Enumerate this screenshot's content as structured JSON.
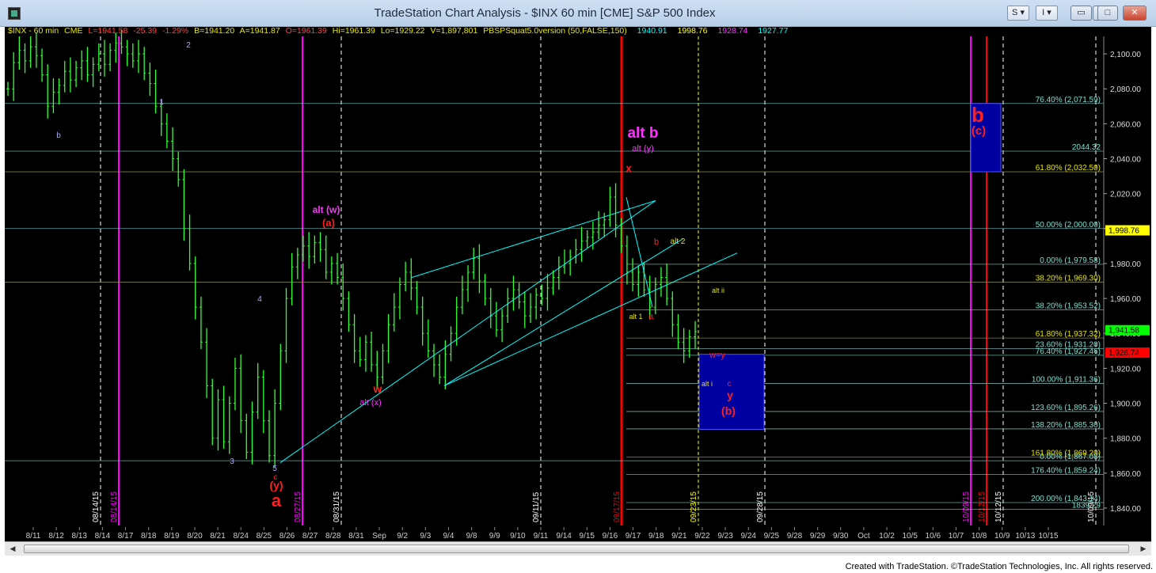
{
  "window": {
    "title": "TradeStation Chart Analysis - $INX 60 min [CME] S&P 500 Index",
    "symbol_button": "S",
    "chart_button": "I"
  },
  "header": {
    "symbol": "$INX - 60 min",
    "exchange": "CME",
    "last": "L=1941.58",
    "change": "-25.39",
    "change_pct": "-1.29%",
    "bid": "B=1941.20",
    "ask": "A=1941.87",
    "open": "O=1961.39",
    "high": "Hi=1961.39",
    "low": "Lo=1929.22",
    "volume": "V=1,897,801",
    "study": "PBSPSquat5.0version (50,FALSE,150)",
    "v1": "1940.91",
    "v2": "1998.76",
    "v3": "1928.74",
    "v4": "1927.77"
  },
  "colors": {
    "background": "#000000",
    "bars": "#33ff33",
    "price_label_up": "#ffff00",
    "price_label_down": "#ff0000",
    "trend_line": "#00ffff",
    "time_marker_magenta": "#ff00ff",
    "time_marker_red": "#ff0000",
    "box": "#0000a0",
    "wave_red": "#ff2020",
    "wave_magenta": "#ff33ff",
    "fib_text": "#7fdfd0",
    "fib_yellow": "#e6e600"
  },
  "chart_data": {
    "type": "bar",
    "instrument": "$INX",
    "interval": "60 min",
    "ylim": [
      1830,
      2110
    ],
    "y_ticks": [
      "2,100.00",
      "2,080.00",
      "2,060.00",
      "2,040.00",
      "2,020.00",
      "2,000.00",
      "1,980.00",
      "1,960.00",
      "1,940.00",
      "1,920.00",
      "1,900.00",
      "1,880.00",
      "1,860.00",
      "1,840.00"
    ],
    "y_tick_values": [
      2100,
      2080,
      2060,
      2040,
      2020,
      2000,
      1980,
      1960,
      1940,
      1920,
      1900,
      1880,
      1860,
      1840
    ],
    "x_labels": [
      "8/11",
      "8/12",
      "8/13",
      "8/14",
      "8/17",
      "8/18",
      "8/19",
      "8/20",
      "8/21",
      "8/24",
      "8/25",
      "8/26",
      "8/27",
      "8/28",
      "8/31",
      "Sep",
      "9/2",
      "9/3",
      "9/4",
      "9/8",
      "9/9",
      "9/10",
      "9/11",
      "9/14",
      "9/15",
      "9/16",
      "9/17",
      "9/18",
      "9/21",
      "9/22",
      "9/23",
      "9/24",
      "9/25",
      "9/28",
      "9/29",
      "9/30",
      "Oct",
      "10/2",
      "10/5",
      "10/6",
      "10/7",
      "10/8",
      "10/9",
      "10/13",
      "10/15"
    ],
    "price_markers": [
      {
        "label": "1,998.76",
        "value": 1998.76,
        "color": "#ffff00"
      },
      {
        "label": "1,941.58",
        "value": 1941.58,
        "color": "#00ff00"
      },
      {
        "label": "1,928.74",
        "value": 1928.74,
        "color": "#ff0000"
      }
    ],
    "fib_levels": [
      {
        "label": "76.40% (2,071.59)",
        "value": 2071.59
      },
      {
        "label": "2044.32",
        "value": 2044.32
      },
      {
        "label": "61.80% (2,032.50)",
        "value": 2032.5
      },
      {
        "label": "50.00% (2,000.00)",
        "value": 2000.0
      },
      {
        "label": "0.00% (1,979.58)",
        "value": 1979.58
      },
      {
        "label": "38.20% (1,969.30)",
        "value": 1969.3
      },
      {
        "label": "38.20% (1,953.52)",
        "value": 1953.52
      },
      {
        "label": "61.80% (1,937.32)",
        "value": 1937.32
      },
      {
        "label": "23.60% (1,931.20)",
        "value": 1931.2
      },
      {
        "label": "76.40% (1,927.46)",
        "value": 1927.46
      },
      {
        "label": "100.00% (1,911.36)",
        "value": 1911.36
      },
      {
        "label": "123.60% (1,895.26)",
        "value": 1895.26
      },
      {
        "label": "138.20% (1,885.30)",
        "value": 1885.3
      },
      {
        "label": "161.80% (1,869.20)",
        "value": 1869.2
      },
      {
        "label": "0.00% (1,867.08)",
        "value": 1867.08
      },
      {
        "label": "176.40% (1,859.24)",
        "value": 1859.24
      },
      {
        "label": "200.00% (1,843.14)",
        "value": 1843.14
      },
      {
        "label": "1839.29",
        "value": 1839.29
      }
    ],
    "date_markers": [
      {
        "label": "08/14/15",
        "color": "#ffffff"
      },
      {
        "label": "08/14/15",
        "color": "#ff00ff"
      },
      {
        "label": "08/27/15",
        "color": "#ff00ff"
      },
      {
        "label": "08/31/15",
        "color": "#ffffff"
      },
      {
        "label": "09/11/15",
        "color": "#ffffff"
      },
      {
        "label": "09/17/15",
        "color": "#ff0000"
      },
      {
        "label": "09/23/15",
        "color": "#ffff00"
      },
      {
        "label": "09/28/15",
        "color": "#ffffff"
      },
      {
        "label": "10/09/15",
        "color": "#ff00ff"
      },
      {
        "label": "10/12/15",
        "color": "#ff0000"
      },
      {
        "label": "10/12/15",
        "color": "#ffffff"
      },
      {
        "label": "10/09/15",
        "color": "#ffffff"
      }
    ],
    "wave_labels": [
      {
        "label": "b",
        "color": "#aaaaff"
      },
      {
        "label": "1",
        "color": "#aaaaff"
      },
      {
        "label": "2",
        "color": "#aaaaff"
      },
      {
        "label": "3",
        "color": "#aaaaff"
      },
      {
        "label": "4",
        "color": "#aaaaff"
      },
      {
        "label": "5",
        "color": "#aaaaff"
      },
      {
        "label": "c",
        "color": "#ff2020"
      },
      {
        "label": "(y)",
        "color": "#ff2020"
      },
      {
        "label": "a",
        "color": "#ff2020"
      },
      {
        "label": "alt (w)",
        "color": "#ff33ff"
      },
      {
        "label": "(a)",
        "color": "#ff2020"
      },
      {
        "label": "w",
        "color": "#ff2020"
      },
      {
        "label": "alt (x)",
        "color": "#ff33ff"
      },
      {
        "label": "alt b",
        "color": "#ff33ff"
      },
      {
        "label": "alt (y)",
        "color": "#ff33ff"
      },
      {
        "label": "x",
        "color": "#ff2020"
      },
      {
        "label": "b",
        "color": "#ff2020"
      },
      {
        "label": "alt 2",
        "color": "#e6e600"
      },
      {
        "label": "alt ii",
        "color": "#e6e600"
      },
      {
        "label": "alt 1",
        "color": "#e6e600"
      },
      {
        "label": "a",
        "color": "#ff2020"
      },
      {
        "label": "w=y",
        "color": "#ff2020"
      },
      {
        "label": "alt i",
        "color": "#e6e600"
      },
      {
        "label": "c",
        "color": "#ff2020"
      },
      {
        "label": "y",
        "color": "#ff2020"
      },
      {
        "label": "(b)",
        "color": "#ff2020"
      },
      {
        "label": "b",
        "color": "#ff2020"
      },
      {
        "label": "(c)",
        "color": "#ff2020"
      }
    ],
    "price_path": [
      2080,
      2095,
      2102,
      2096,
      2104,
      2099,
      2088,
      2070,
      2078,
      2082,
      2090,
      2085,
      2092,
      2096,
      2088,
      2094,
      2100,
      2094,
      2102,
      2106,
      2104,
      2100,
      2096,
      2100,
      2089,
      2083,
      2070,
      2060,
      2050,
      2040,
      2028,
      2000,
      1980,
      1955,
      1935,
      1910,
      1880,
      1902,
      1878,
      1900,
      1920,
      1890,
      1872,
      1895,
      1915,
      1890,
      1870,
      1900,
      1930,
      1960,
      1978,
      1985,
      1990,
      1984,
      1992,
      1988,
      1975,
      1980,
      1972,
      1960,
      1945,
      1930,
      1925,
      1935,
      1922,
      1915,
      1930,
      1945,
      1955,
      1968,
      1975,
      1966,
      1955,
      1940,
      1930,
      1922,
      1915,
      1928,
      1940,
      1955,
      1965,
      1975,
      1983,
      1970,
      1960,
      1950,
      1942,
      1950,
      1960,
      1965,
      1958,
      1950,
      1955,
      1962,
      1960,
      1966,
      1972,
      1978,
      1980,
      1984,
      1988,
      1993,
      1995,
      1998,
      2002,
      2005,
      2018,
      2002,
      1990,
      1975,
      1968,
      1975,
      1965,
      1955,
      1968,
      1972,
      1960,
      1945,
      1935,
      1930,
      1938,
      1941
    ]
  },
  "footer": {
    "credit": "Created with TradeStation. ©TradeStation Technologies, Inc. All rights reserved."
  }
}
